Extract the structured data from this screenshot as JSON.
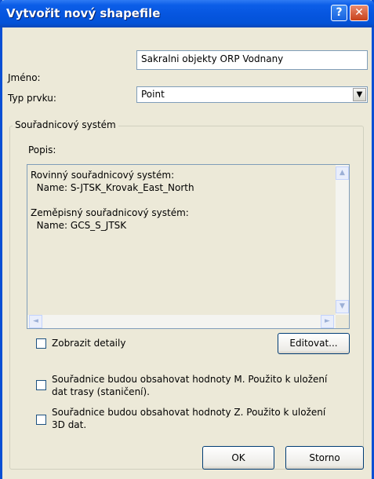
{
  "window": {
    "title": "Vytvořit nový shapefile"
  },
  "titlebar_buttons": {
    "help": "?",
    "close": "✕"
  },
  "form": {
    "name_label": "Jméno:",
    "name_value": "Sakralni objekty ORP Vodnany",
    "type_label": "Typ prvku:",
    "type_value": "Point",
    "dropdown_arrow": "▼"
  },
  "coordinate_system": {
    "group_label": "Souřadnicový systém",
    "description_label": "Popis:",
    "description_text": "Rovinný souřadnicový systém:\n  Name: S-JTSK_Krovak_East_North\n\nZeměpisný souřadnicový systém:\n  Name: GCS_S_JTSK",
    "scroll_up": "▲",
    "scroll_down": "▼",
    "scroll_left": "◄",
    "scroll_right": "►",
    "show_details_label": "Zobrazit detaily",
    "edit_button": "Editovat..."
  },
  "options": {
    "m_values_label": "Souřadnice budou obsahovat hodnoty M. Použito k uložení\ndat trasy (staničení).",
    "z_values_label": "Souřadnice budou obsahovat hodnoty Z. Použito k uložení\n3D dat."
  },
  "footer": {
    "ok_label": "OK",
    "cancel_label": "Storno"
  },
  "colors": {
    "titlebar": "#0656e0",
    "dialog_bg": "#ece9d8",
    "field_border": "#7f9db9"
  }
}
